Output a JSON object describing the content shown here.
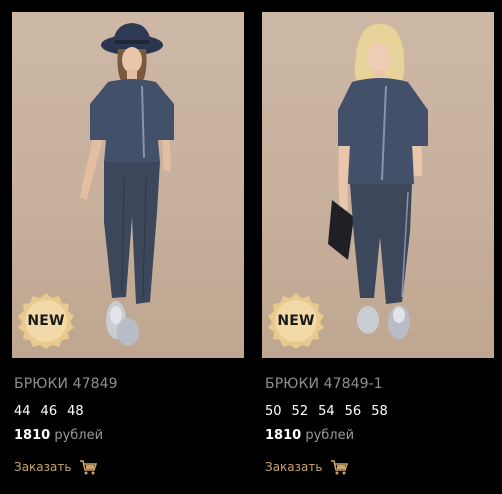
{
  "products": [
    {
      "title": "БРЮКИ 47849",
      "sizes": [
        "44",
        "46",
        "48"
      ],
      "price": "1810",
      "currency": "рублей",
      "order_label": "Заказать",
      "badge": "NEW"
    },
    {
      "title": "БРЮКИ 47849-1",
      "sizes": [
        "50",
        "52",
        "54",
        "56",
        "58"
      ],
      "price": "1810",
      "currency": "рублей",
      "order_label": "Заказать",
      "badge": "NEW"
    }
  ],
  "colors": {
    "background": "#000000",
    "photo_bg": "#c9b3a0",
    "garment": "#3f4a5f",
    "title_text": "#8f8f8f",
    "order_link": "#c9a36a",
    "badge_gold": "#e8c98e"
  },
  "icons": {
    "cart": "shopping-cart-icon"
  }
}
